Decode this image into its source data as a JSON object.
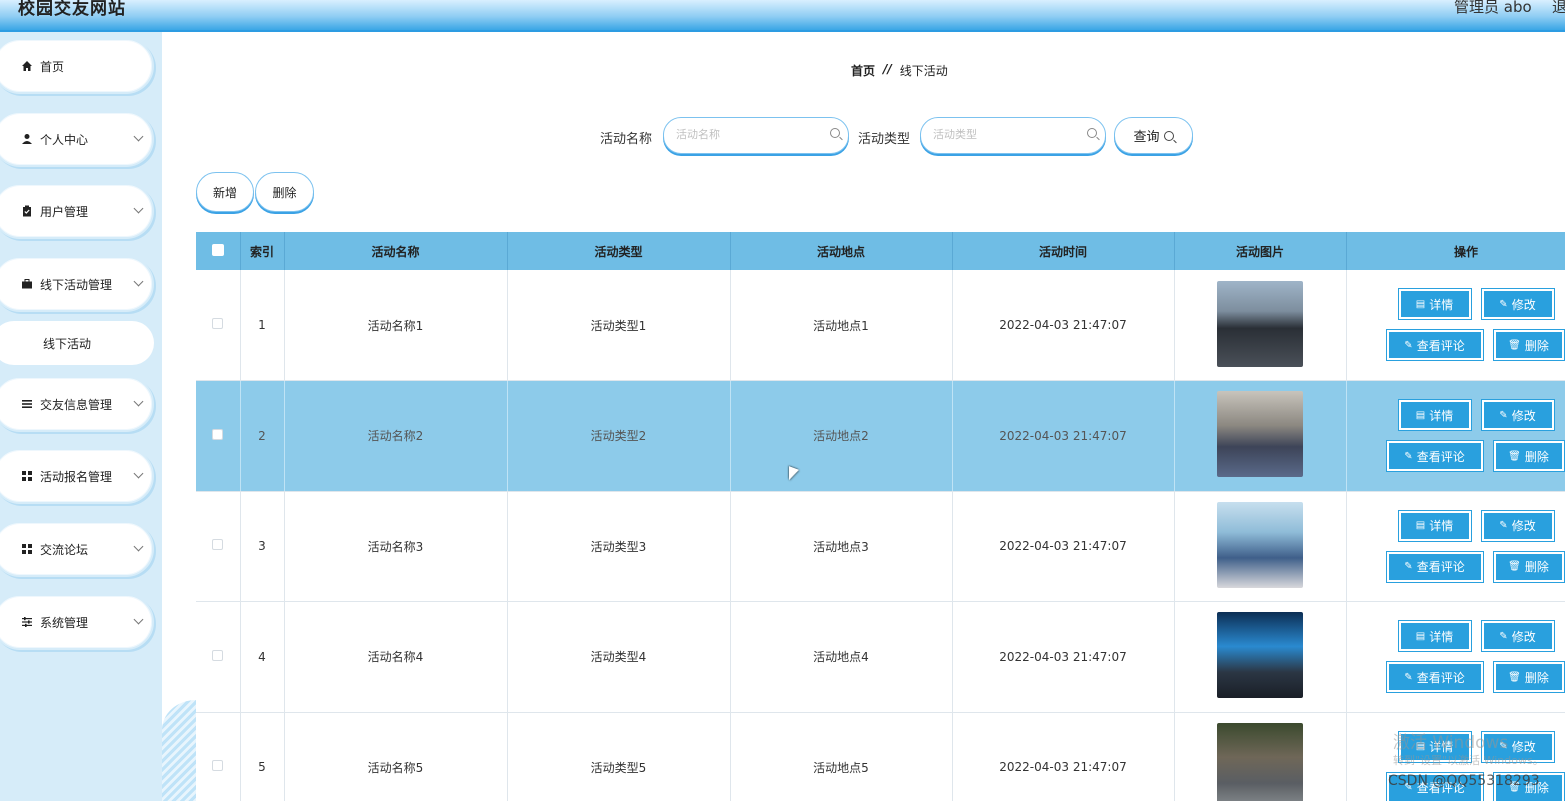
{
  "header": {
    "title": "校园交友网站",
    "admin": "管理员 abo",
    "logout": "退出"
  },
  "sidebar": {
    "items": [
      {
        "label": "首页",
        "icon": "home-icon",
        "expandable": false
      },
      {
        "label": "个人中心",
        "icon": "user-icon",
        "expandable": true
      },
      {
        "label": "用户管理",
        "icon": "clipboard-icon",
        "expandable": true
      },
      {
        "label": "线下活动管理",
        "icon": "briefcase-icon",
        "expandable": true
      },
      {
        "label": "交友信息管理",
        "icon": "list-icon",
        "expandable": true
      },
      {
        "label": "活动报名管理",
        "icon": "grid-icon",
        "expandable": true
      },
      {
        "label": "交流论坛",
        "icon": "grid-icon",
        "expandable": true
      },
      {
        "label": "系统管理",
        "icon": "sliders-icon",
        "expandable": true
      }
    ],
    "sub_item": "线下活动"
  },
  "breadcrumb": {
    "home": "首页",
    "separator": "//",
    "current": "线下活动"
  },
  "search": {
    "name_label": "活动名称",
    "name_placeholder": "活动名称",
    "type_label": "活动类型",
    "type_placeholder": "活动类型",
    "query_label": "查询"
  },
  "actions": {
    "add": "新增",
    "delete": "删除"
  },
  "table": {
    "headers": [
      "索引",
      "活动名称",
      "活动类型",
      "活动地点",
      "活动时间",
      "活动图片",
      "操作"
    ],
    "rows": [
      {
        "index": "1",
        "name": "活动名称1",
        "type": "活动类型1",
        "place": "活动地点1",
        "time": "2022-04-03 21:47:07"
      },
      {
        "index": "2",
        "name": "活动名称2",
        "type": "活动类型2",
        "place": "活动地点2",
        "time": "2022-04-03 21:47:07"
      },
      {
        "index": "3",
        "name": "活动名称3",
        "type": "活动类型3",
        "place": "活动地点3",
        "time": "2022-04-03 21:47:07"
      },
      {
        "index": "4",
        "name": "活动名称4",
        "type": "活动类型4",
        "place": "活动地点4",
        "time": "2022-04-03 21:47:07"
      },
      {
        "index": "5",
        "name": "活动名称5",
        "type": "活动类型5",
        "place": "活动地点5",
        "time": "2022-04-03 21:47:07"
      }
    ],
    "highlighted_row": 2,
    "op_labels": {
      "detail": "详情",
      "edit": "修改",
      "comments": "查看评论",
      "delete": "删除"
    }
  },
  "watermark": {
    "line1": "激活 Windows",
    "line2": "转到\"设置\"以激活 Windows。",
    "credit": "CSDN @QQ55318293"
  },
  "colors": {
    "header_blue": "#3aa6e6",
    "table_header": "#6fbde5",
    "highlight_row": "#8dcbea",
    "op_button": "#29a0de",
    "sidebar_bg": "#d6ecf9"
  }
}
